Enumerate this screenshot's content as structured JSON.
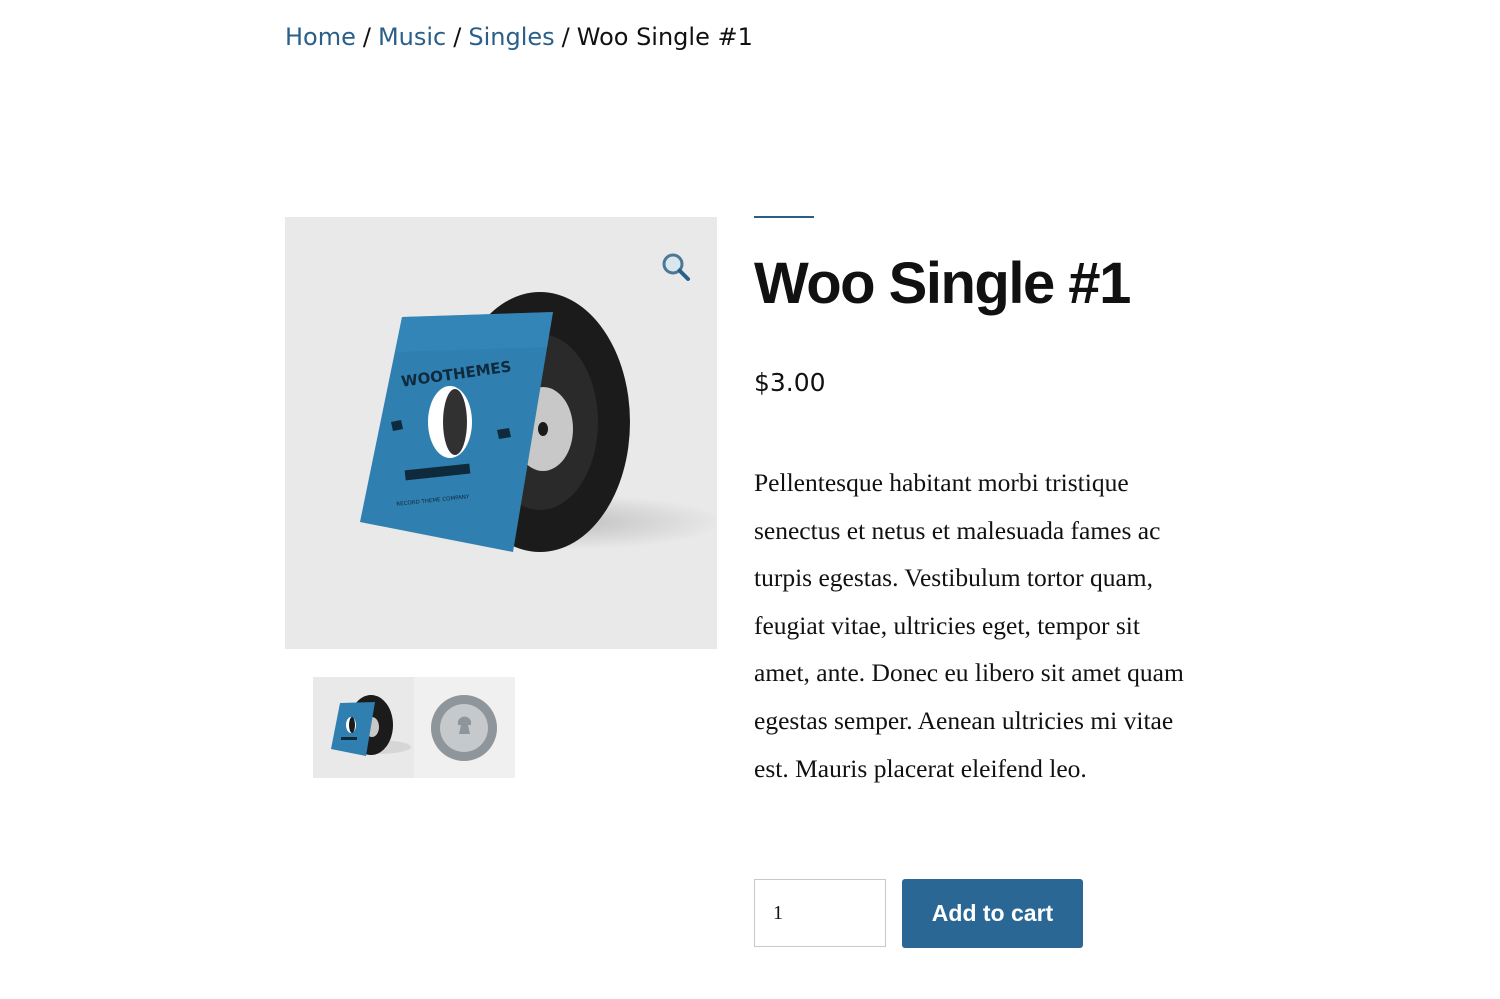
{
  "breadcrumb": {
    "items": [
      {
        "label": "Home"
      },
      {
        "label": "Music"
      },
      {
        "label": "Singles"
      }
    ],
    "separator": "/",
    "current": "Woo Single #1"
  },
  "gallery": {
    "zoom_icon": "magnifier-icon",
    "cover_text": "WOOTHEMES",
    "cover_subtext": "RECORD THEME COMPANY",
    "thumbnails": [
      {
        "name": "record-sleeve-thumbnail"
      },
      {
        "name": "vinyl-label-thumbnail"
      }
    ]
  },
  "product": {
    "title": "Woo Single #1",
    "price": "$3.00",
    "description": "Pellentesque habitant morbi tristique senectus et netus et malesuada fames ac turpis egestas. Vestibulum tortor quam, feugiat vitae, ultricies eget, tempor sit amet, ante. Donec eu libero sit amet quam egestas semper. Aenean ultricies mi vitae est. Mauris placerat eleifend leo.",
    "quantity": "1",
    "add_to_cart_label": "Add to cart"
  },
  "colors": {
    "accent": "#2a5f8a",
    "button": "#2b6795",
    "gallery_bg": "#e9e9e9"
  }
}
